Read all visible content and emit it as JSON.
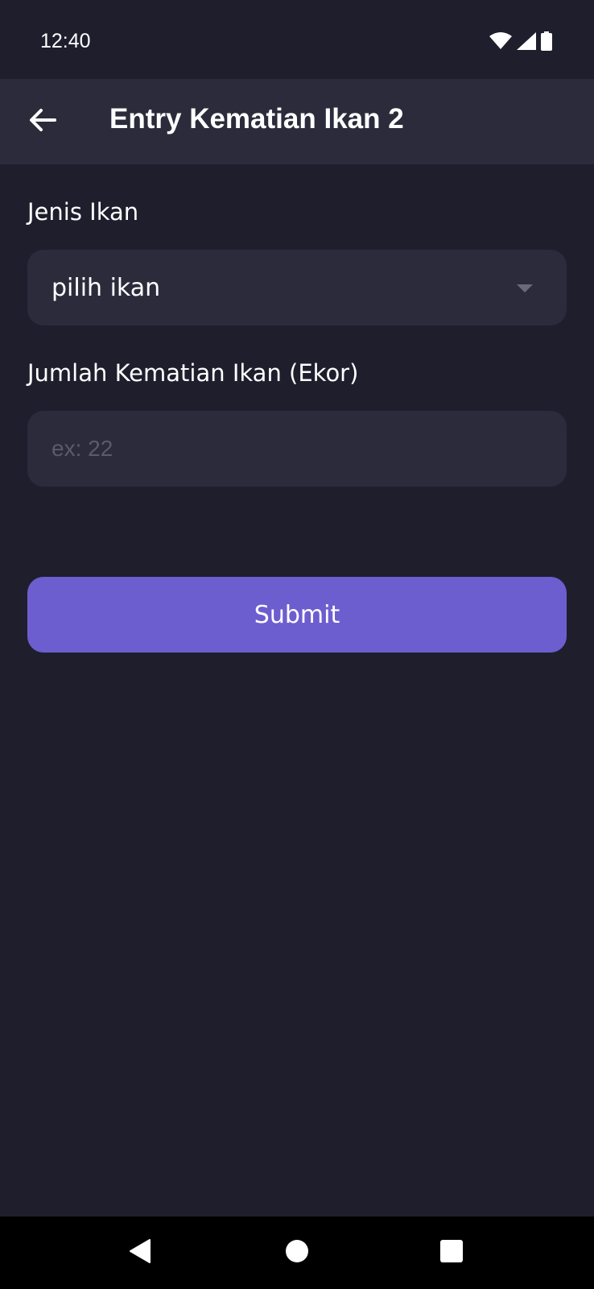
{
  "status_bar": {
    "time": "12:40",
    "icons": [
      "wifi-icon",
      "signal-icon",
      "battery-icon"
    ]
  },
  "app_bar": {
    "back_icon": "arrow-left-icon",
    "title": "Entry Kematian Ikan 2"
  },
  "form": {
    "fish_type": {
      "label": "Jenis Ikan",
      "selected_value": "pilih ikan"
    },
    "death_count": {
      "label": "Jumlah Kematian Ikan (Ekor)",
      "value": "",
      "placeholder": "ex: 22"
    },
    "submit_label": "Submit"
  },
  "nav_bar": {
    "icons": [
      "nav-back-icon",
      "nav-home-icon",
      "nav-recents-icon"
    ]
  },
  "colors": {
    "background": "#1f1e2d",
    "surface": "#2c2b3b",
    "accent": "#6c5ecf",
    "text": "#ffffff",
    "placeholder": "#5b5a6b"
  }
}
